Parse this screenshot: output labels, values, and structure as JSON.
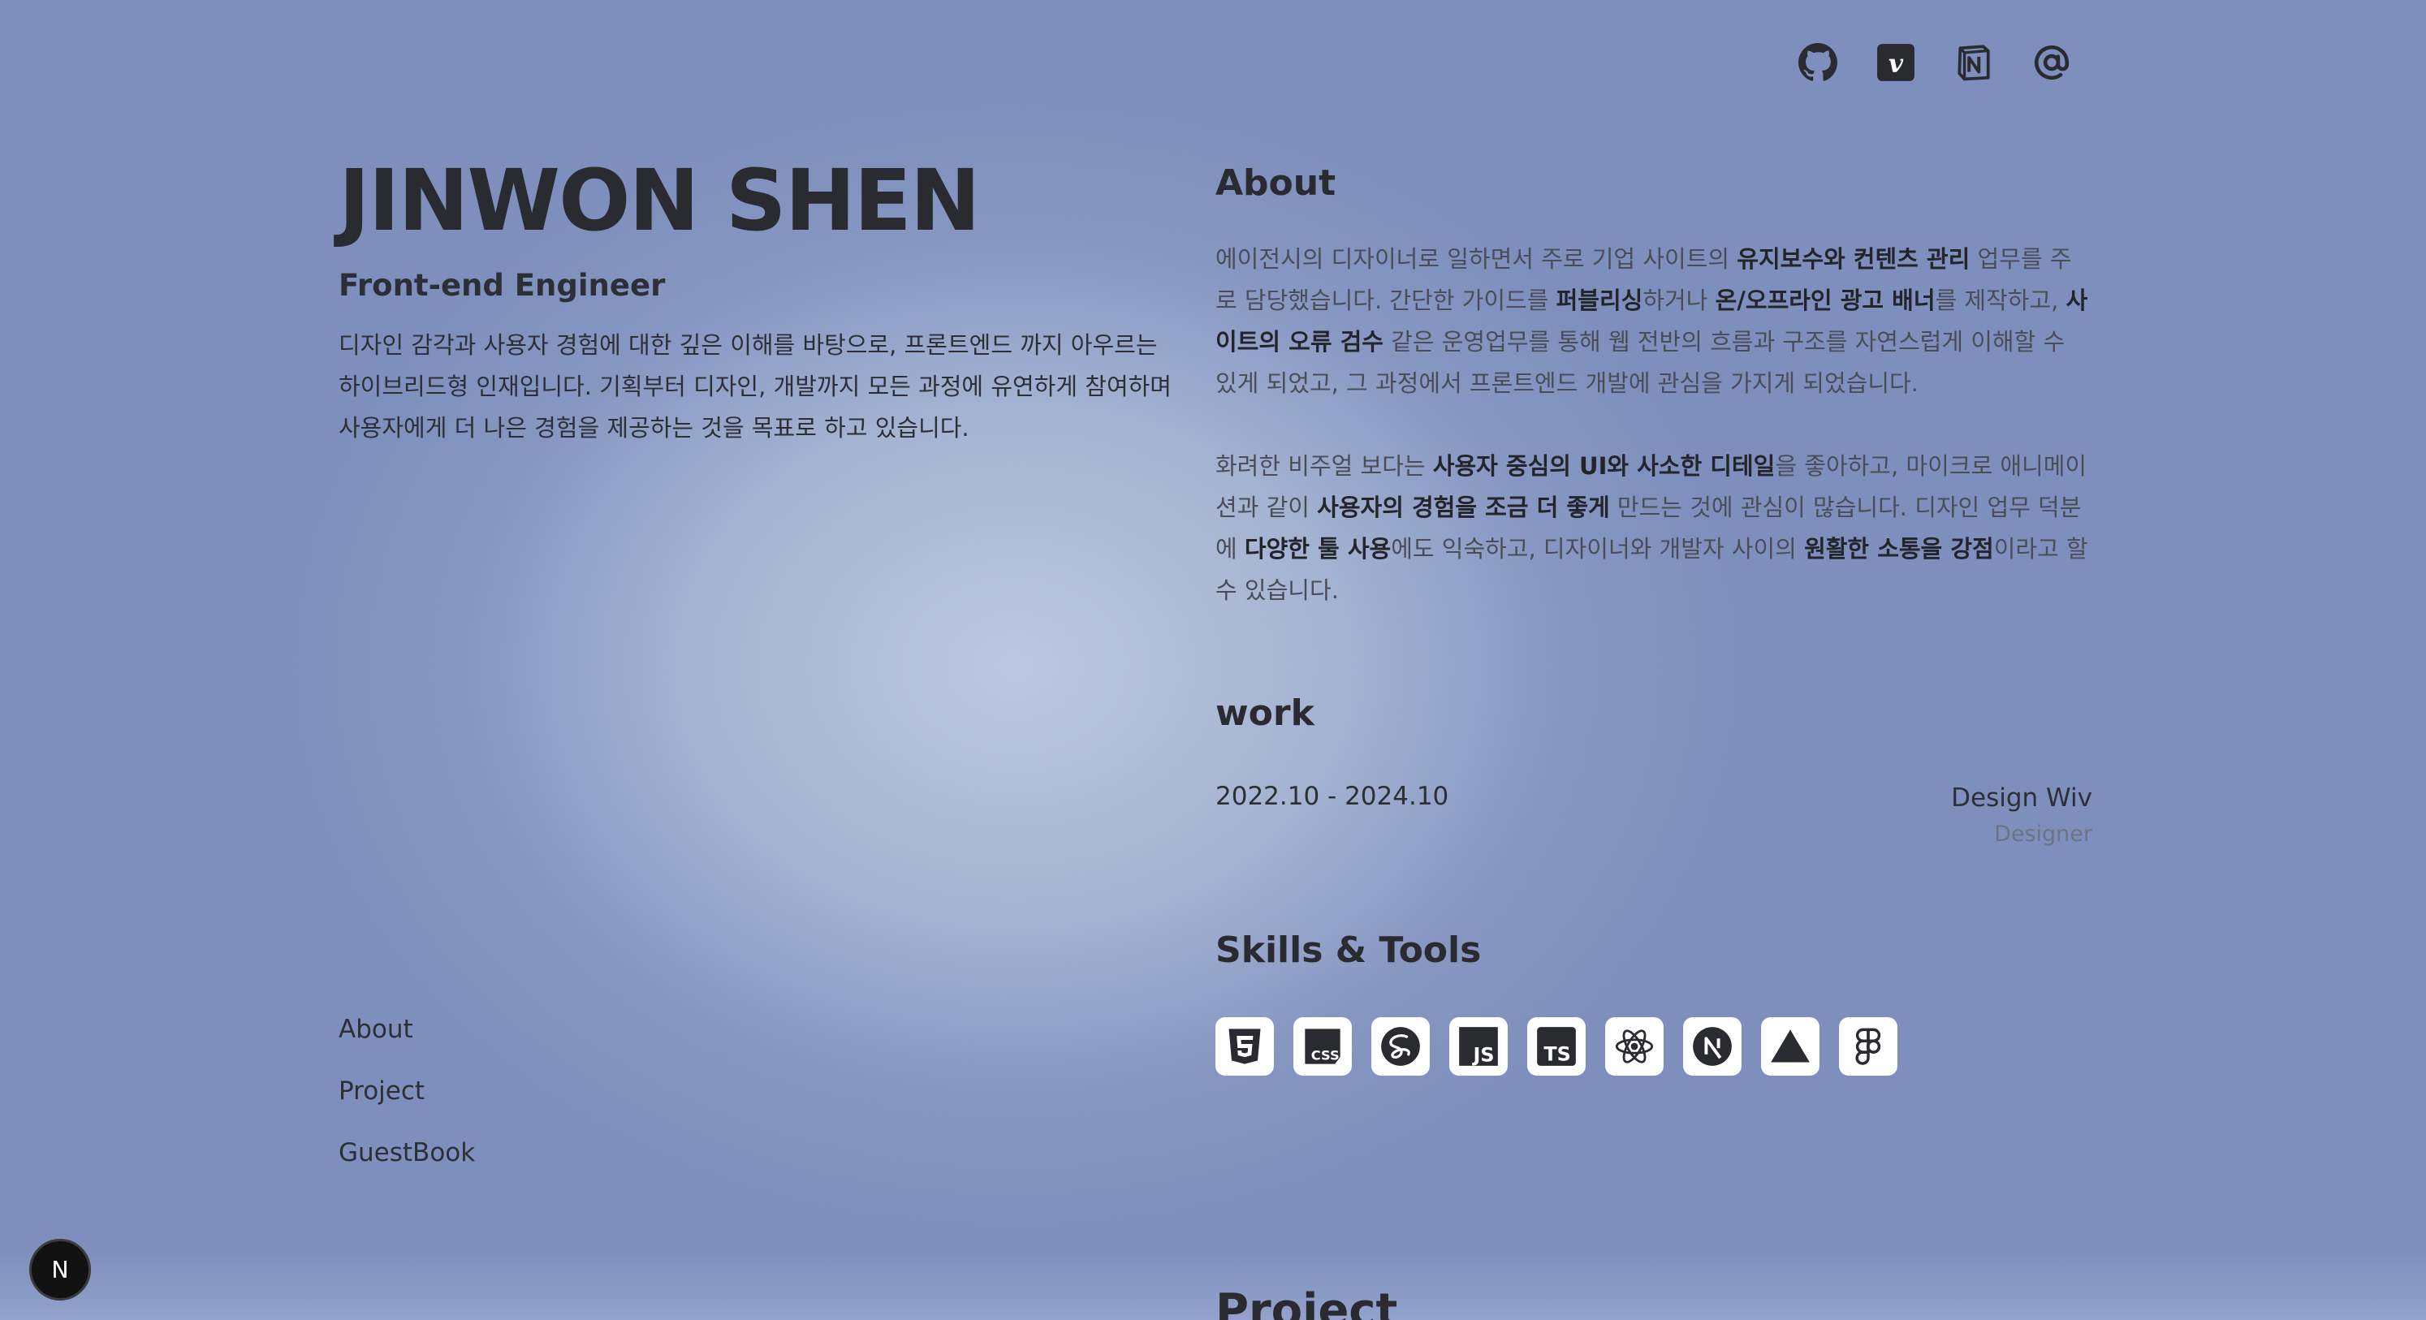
{
  "header": {
    "icons": [
      "github-icon",
      "vimeo-icon",
      "notion-icon",
      "email-icon"
    ]
  },
  "profile": {
    "name": "JINWON SHEN",
    "role": "Front-end Engineer",
    "intro": "디자인 감각과 사용자 경험에 대한 깊은 이해를 바탕으로, 프론트엔드 까지 아우르는 하이브리드형 인재입니다. 기획부터 디자인, 개발까지 모든 과정에 유연하게 참여하며 사용자에게 더 나은 경험을 제공하는 것을 목표로 하고 있습니다."
  },
  "nav": {
    "items": [
      "About",
      "Project",
      "GuestBook"
    ]
  },
  "about": {
    "title": "About",
    "p1": [
      {
        "t": "에이전시의 디자이너로 일하면서 주로 기업 사이트의 ",
        "b": false
      },
      {
        "t": "유지보수와 컨텐츠 관리",
        "b": true
      },
      {
        "t": " 업무를 주로 담당했습니다. 간단한 가이드를 ",
        "b": false
      },
      {
        "t": "퍼블리싱",
        "b": true
      },
      {
        "t": "하거나 ",
        "b": false
      },
      {
        "t": "온/오프라인 광고 배너",
        "b": true
      },
      {
        "t": "를 제작하고, ",
        "b": false
      },
      {
        "t": "사이트의 오류 검수",
        "b": true
      },
      {
        "t": " 같은 운영업무를 통해 웹 전반의 흐름과 구조를 자연스럽게 이해할 수 있게 되었고, 그 과정에서 프론트엔드 개발에 관심을 가지게 되었습니다.",
        "b": false
      }
    ],
    "p2": [
      {
        "t": "화려한 비주얼 보다는 ",
        "b": false
      },
      {
        "t": "사용자 중심의 UI와 사소한 디테일",
        "b": true
      },
      {
        "t": "을 좋아하고, 마이크로 애니메이션과 같이 ",
        "b": false
      },
      {
        "t": "사용자의 경험을 조금 더 좋게",
        "b": true
      },
      {
        "t": " 만드는 것에 관심이 많습니다. 디자인 업무 덕분에 ",
        "b": false
      },
      {
        "t": "다양한 툴 사용",
        "b": true
      },
      {
        "t": "에도 익숙하고, 디자이너와 개발자 사이의 ",
        "b": false
      },
      {
        "t": "원활한 소통을 강점",
        "b": true
      },
      {
        "t": "이라고 할 수 있습니다.",
        "b": false
      }
    ]
  },
  "work": {
    "title": "work",
    "entries": [
      {
        "period": "2022.10 - 2024.10",
        "company": "Design Wiv",
        "role": "Designer"
      }
    ]
  },
  "skills": {
    "title": "Skills & Tools",
    "items": [
      "html5-icon",
      "css-icon",
      "sass-icon",
      "javascript-icon",
      "typescript-icon",
      "react-icon",
      "nextjs-icon",
      "vercel-icon",
      "figma-icon"
    ]
  },
  "project": {
    "title": "Project"
  },
  "dev_badge": {
    "letter": "N"
  }
}
